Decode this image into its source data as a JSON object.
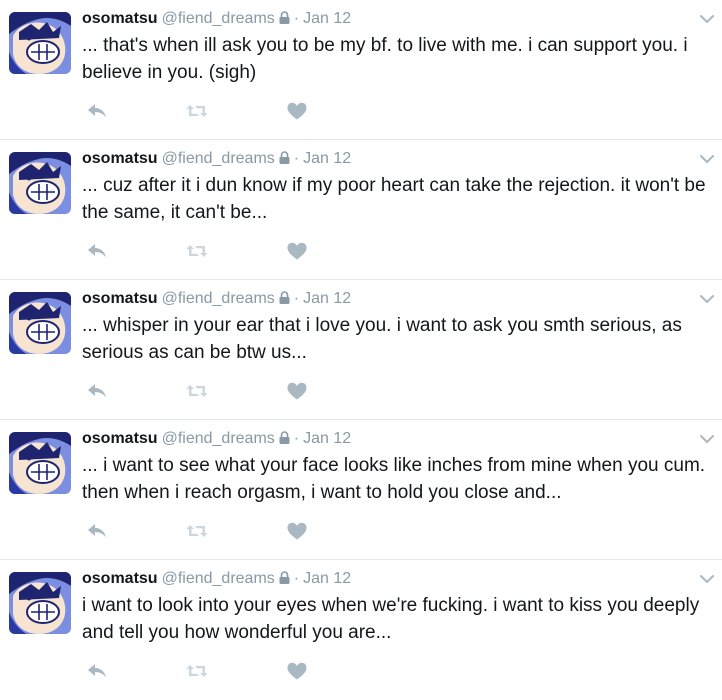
{
  "colors": {
    "name": "#14171a",
    "meta": "#8899a6",
    "icon": "#aab8c2",
    "divider": "#e1e8ed",
    "avatar_bg": "#7c8ee2",
    "avatar_hair": "#1f2470"
  },
  "icons": {
    "reply": "reply-icon",
    "retweet": "retweet-icon",
    "like": "heart-icon",
    "lock": "lock-icon",
    "menu": "chevron-down-icon"
  },
  "tweets": [
    {
      "name": "osomatsu",
      "handle": "@fiend_dreams",
      "separator": "·",
      "date": "Jan 12",
      "text": "... that's when ill ask you to be my bf. to live with me. i can support you. i believe in you. (sigh)"
    },
    {
      "name": "osomatsu",
      "handle": "@fiend_dreams",
      "separator": "·",
      "date": "Jan 12",
      "text": "... cuz after it i dun know if my poor heart can take the rejection. it won't be the same, it can't be..."
    },
    {
      "name": "osomatsu",
      "handle": "@fiend_dreams",
      "separator": "·",
      "date": "Jan 12",
      "text": "... whisper in your ear that i love you. i want to ask you smth serious, as serious as can be btw us..."
    },
    {
      "name": "osomatsu",
      "handle": "@fiend_dreams",
      "separator": "·",
      "date": "Jan 12",
      "text": "... i want to see what your face looks like inches from mine when you cum. then when i reach orgasm, i want to hold you close and..."
    },
    {
      "name": "osomatsu",
      "handle": "@fiend_dreams",
      "separator": "·",
      "date": "Jan 12",
      "text": "i want to look into your eyes when we're fucking. i want to kiss you deeply and tell you how wonderful you are..."
    }
  ]
}
